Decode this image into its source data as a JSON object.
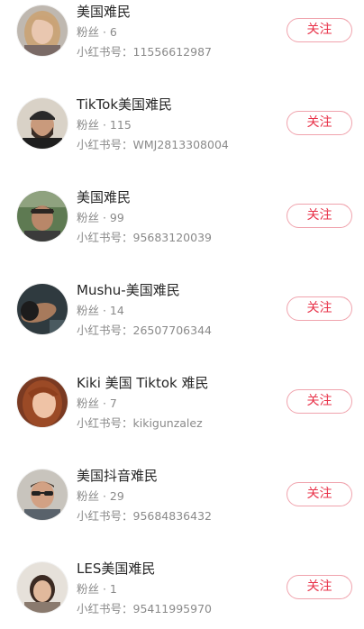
{
  "users": [
    {
      "name": "美国难民",
      "fans_label": "粉丝 · 6",
      "id_label": "小红书号：11556612987",
      "follow_label": "关注",
      "avatar": "blonde-woman-avatar"
    },
    {
      "name": "TikTok美国难民",
      "fans_label": "粉丝 · 115",
      "id_label": "小红书号：WMJ2813308004",
      "follow_label": "关注",
      "avatar": "bearded-man-beanie-avatar"
    },
    {
      "name": "美国难民",
      "fans_label": "粉丝 · 99",
      "id_label": "小红书号：95683120039",
      "follow_label": "关注",
      "avatar": "man-outdoors-avatar"
    },
    {
      "name": "Mushu-美国难民",
      "fans_label": "粉丝 · 14",
      "id_label": "小红书号：26507706344",
      "follow_label": "关注",
      "avatar": "person-lying-avatar"
    },
    {
      "name": "Kiki 美国 Tiktok 难民",
      "fans_label": "粉丝 · 7",
      "id_label": "小红书号：kikigunzalez",
      "follow_label": "关注",
      "avatar": "redhead-woman-avatar"
    },
    {
      "name": "美国抖音难民",
      "fans_label": "粉丝 · 29",
      "id_label": "小红书号：95684836432",
      "follow_label": "关注",
      "avatar": "man-sunglasses-avatar"
    },
    {
      "name": "LES美国难民",
      "fans_label": "粉丝 · 1",
      "id_label": "小红书号：95411995970",
      "follow_label": "关注",
      "avatar": "woman-indoor-avatar"
    }
  ],
  "colors": {
    "follow_text": "#e8334a",
    "follow_border": "#f0a3ad",
    "secondary_text": "#8a8a8a"
  }
}
